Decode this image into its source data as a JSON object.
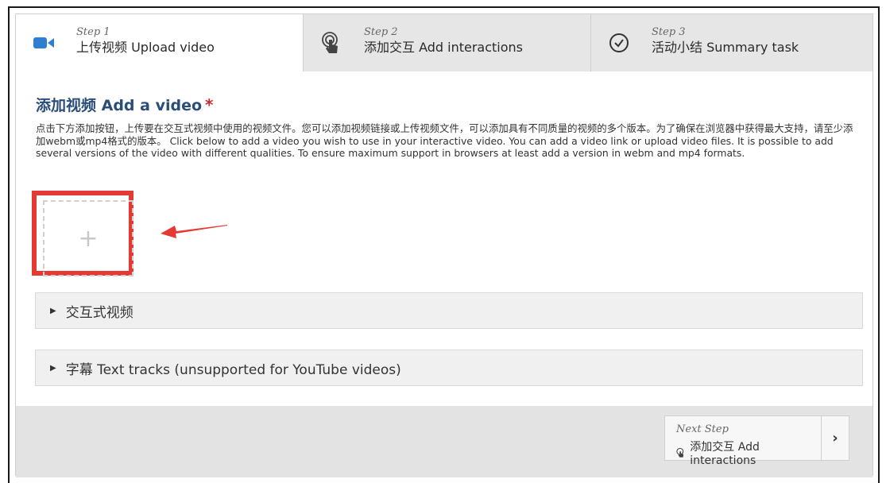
{
  "steps": [
    {
      "num": "Step 1",
      "label": "上传视频 Upload video",
      "icon": "video-camera-icon"
    },
    {
      "num": "Step 2",
      "label": "添加交互 Add interactions",
      "icon": "touch-icon"
    },
    {
      "num": "Step 3",
      "label": "活动小结 Summary task",
      "icon": "check-circle-icon"
    }
  ],
  "section": {
    "title": "添加视频 Add a video",
    "required_mark": "*",
    "description": "点击下方添加按钮，上传要在交互式视频中使用的视频文件。您可以添加视频链接或上传视频文件，可以添加具有不同质量的视频的多个版本。为了确保在浏览器中获得最大支持，请至少添加webm或mp4格式的版本。 Click below to add a video you wish to use in your interactive video. You can add a video link or upload video files. It is possible to add several versions of the video with different qualities. To ensure maximum support in browsers at least add a version in webm and mp4 formats.",
    "add_symbol": "+"
  },
  "accordions": [
    {
      "label": "交互式视频"
    },
    {
      "label": "字幕 Text tracks (unsupported for YouTube videos)"
    }
  ],
  "footer": {
    "next_label": "Next Step",
    "next_step": "添加交互 Add interactions",
    "chevron": "›"
  },
  "colors": {
    "accent": "#2b4d7a",
    "highlight": "#e53935",
    "required": "#cc2a2a"
  }
}
